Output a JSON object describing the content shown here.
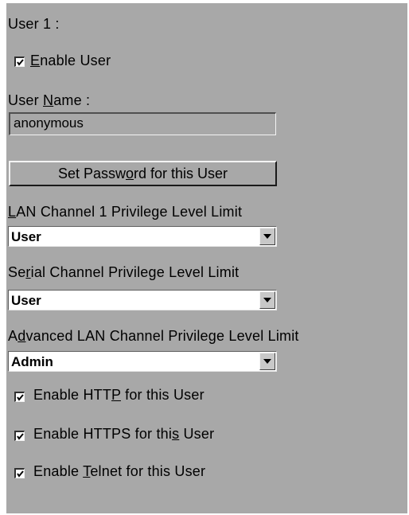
{
  "section_title": "User 1 :",
  "enable_user": {
    "pre": "",
    "mnemonic": "E",
    "post": "nable User",
    "checked": true
  },
  "user_name": {
    "label_pre": "User ",
    "label_mnemonic": "N",
    "label_post": "ame :",
    "value": "anonymous"
  },
  "set_password_button": {
    "pre": "Set Passw",
    "mnemonic": "o",
    "post": "rd for this User"
  },
  "lan_privilege": {
    "label_pre": "",
    "label_mnemonic": "L",
    "label_post": "AN Channel 1 Privilege Level Limit",
    "value": "User"
  },
  "serial_privilege": {
    "label_pre": "Se",
    "label_mnemonic": "r",
    "label_post": "ial Channel Privilege Level Limit",
    "value": "User"
  },
  "advanced_lan_privilege": {
    "label_pre": "A",
    "label_mnemonic": "d",
    "label_post": "vanced LAN Channel Privilege Level Limit",
    "value": "Admin"
  },
  "enable_http": {
    "pre": "Enable HTT",
    "mnemonic": "P",
    "post": " for this User",
    "checked": true
  },
  "enable_https": {
    "pre": "Enable HTTPS for thi",
    "mnemonic": "s",
    "post": " User",
    "checked": true
  },
  "enable_telnet": {
    "pre": "Enable ",
    "mnemonic": "T",
    "post": "elnet for this User",
    "checked": true
  },
  "colors": {
    "panel": "#a8a8a8",
    "field_bg": "#ffffff",
    "text": "#000000"
  }
}
